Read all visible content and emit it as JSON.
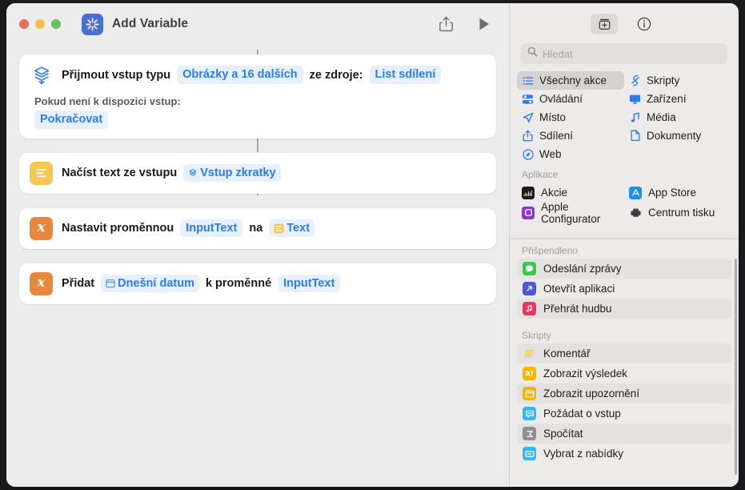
{
  "window": {
    "title": "Add Variable",
    "app_icon": "sparkle-icon",
    "traffic_lights": [
      "close",
      "minimize",
      "zoom"
    ],
    "toolbar_right": [
      {
        "name": "share-icon",
        "label": "Sdílet"
      },
      {
        "name": "play-icon",
        "label": "Spustit"
      }
    ]
  },
  "flow": {
    "actions": [
      {
        "icon": "receive-input-icon",
        "icon_style": "plain",
        "parts": [
          {
            "type": "text",
            "value": "Přijmout vstup typu"
          },
          {
            "type": "token",
            "value": "Obrázky a 16 dalších"
          },
          {
            "type": "text",
            "value": "ze zdroje:"
          },
          {
            "type": "token",
            "value": "List sdílení"
          }
        ],
        "sub_label": "Pokud není k dispozici vstup:",
        "sub_token": "Pokračovat"
      },
      {
        "icon": "text-lines-icon",
        "icon_style": "yellow",
        "parts": [
          {
            "type": "text",
            "value": "Načíst text ze vstupu"
          },
          {
            "type": "token",
            "value": "Vstup zkratky",
            "glyph": "shortcut-input-icon"
          }
        ]
      },
      {
        "icon": "variable-x-icon",
        "icon_style": "orange",
        "glyph": "x",
        "parts": [
          {
            "type": "text",
            "value": "Nastavit proměnnou"
          },
          {
            "type": "token",
            "value": "InputText"
          },
          {
            "type": "text",
            "value": "na"
          },
          {
            "type": "token",
            "value": "Text",
            "glyph": "text-lines-icon"
          }
        ]
      },
      {
        "icon": "variable-x-icon",
        "icon_style": "orange",
        "glyph": "x",
        "parts": [
          {
            "type": "text",
            "value": "Přidat"
          },
          {
            "type": "token",
            "value": "Dnešní datum",
            "glyph": "calendar-icon"
          },
          {
            "type": "text",
            "value": "k proměnné"
          },
          {
            "type": "token",
            "value": "InputText"
          }
        ]
      }
    ]
  },
  "sidebar": {
    "toolbar": [
      {
        "name": "action-library-icon",
        "active": true
      },
      {
        "name": "info-icon",
        "active": false
      }
    ],
    "search": {
      "placeholder": "Hledat",
      "value": "",
      "icon": "search-icon"
    },
    "categories": [
      {
        "label": "Všechny akce",
        "icon": "list-bullets-icon",
        "selected": true
      },
      {
        "label": "Skripty",
        "icon": "scripting-icon",
        "selected": false
      },
      {
        "label": "Ovládání",
        "icon": "sliders-icon",
        "selected": false
      },
      {
        "label": "Zařízení",
        "icon": "display-icon",
        "selected": false
      },
      {
        "label": "Místo",
        "icon": "location-arrow-icon",
        "selected": false
      },
      {
        "label": "Média",
        "icon": "music-note-icon",
        "selected": false
      },
      {
        "label": "Sdílení",
        "icon": "share-up-icon",
        "selected": false
      },
      {
        "label": "Dokumenty",
        "icon": "document-icon",
        "selected": false
      },
      {
        "label": "Web",
        "icon": "safari-compass-icon",
        "selected": false
      }
    ],
    "apps_section": {
      "title": "Aplikace",
      "items": [
        {
          "label": "Akcie",
          "icon": "stocks-app-icon",
          "color": "#1c1c1e"
        },
        {
          "label": "App Store",
          "icon": "appstore-app-icon",
          "color": "#1f8ff2"
        },
        {
          "label": "Apple Configurator",
          "icon": "configurator-app-icon",
          "color": "#8c39c9"
        },
        {
          "label": "Centrum tisku",
          "icon": "print-center-icon",
          "color": "#3d3d42"
        }
      ]
    },
    "pinned_section": {
      "title": "Přišpendleno",
      "items": [
        {
          "label": "Odeslání zprávy",
          "icon": "messages-icon",
          "color": "#32cc45"
        },
        {
          "label": "Otevřít aplikaci",
          "icon": "open-app-icon",
          "color": "#5455d6"
        },
        {
          "label": "Přehrát hudbu",
          "icon": "music-icon",
          "color": "#f0335a"
        }
      ]
    },
    "scripts_section": {
      "title": "Skripty",
      "items": [
        {
          "label": "Komentář",
          "icon": "comment-icon",
          "color": "#f5c750"
        },
        {
          "label": "Zobrazit výsledek",
          "icon": "show-result-icon",
          "color": "#f7b500"
        },
        {
          "label": "Zobrazit upozornění",
          "icon": "show-alert-icon",
          "color": "#f7b500"
        },
        {
          "label": "Požádat o vstup",
          "icon": "ask-input-icon",
          "color": "#38b6f2"
        },
        {
          "label": "Spočítat",
          "icon": "calculate-icon",
          "color": "#8e8e93"
        },
        {
          "label": "Vybrat z nabídky",
          "icon": "choose-menu-icon",
          "color": "#38b6f2"
        }
      ]
    }
  },
  "colors": {
    "accent_blue": "#2b7bf3",
    "token_bg": "#e7f0fe",
    "window_bg": "#ececec",
    "sidebar_bg": "#edeaea",
    "card_bg": "#ffffff"
  }
}
